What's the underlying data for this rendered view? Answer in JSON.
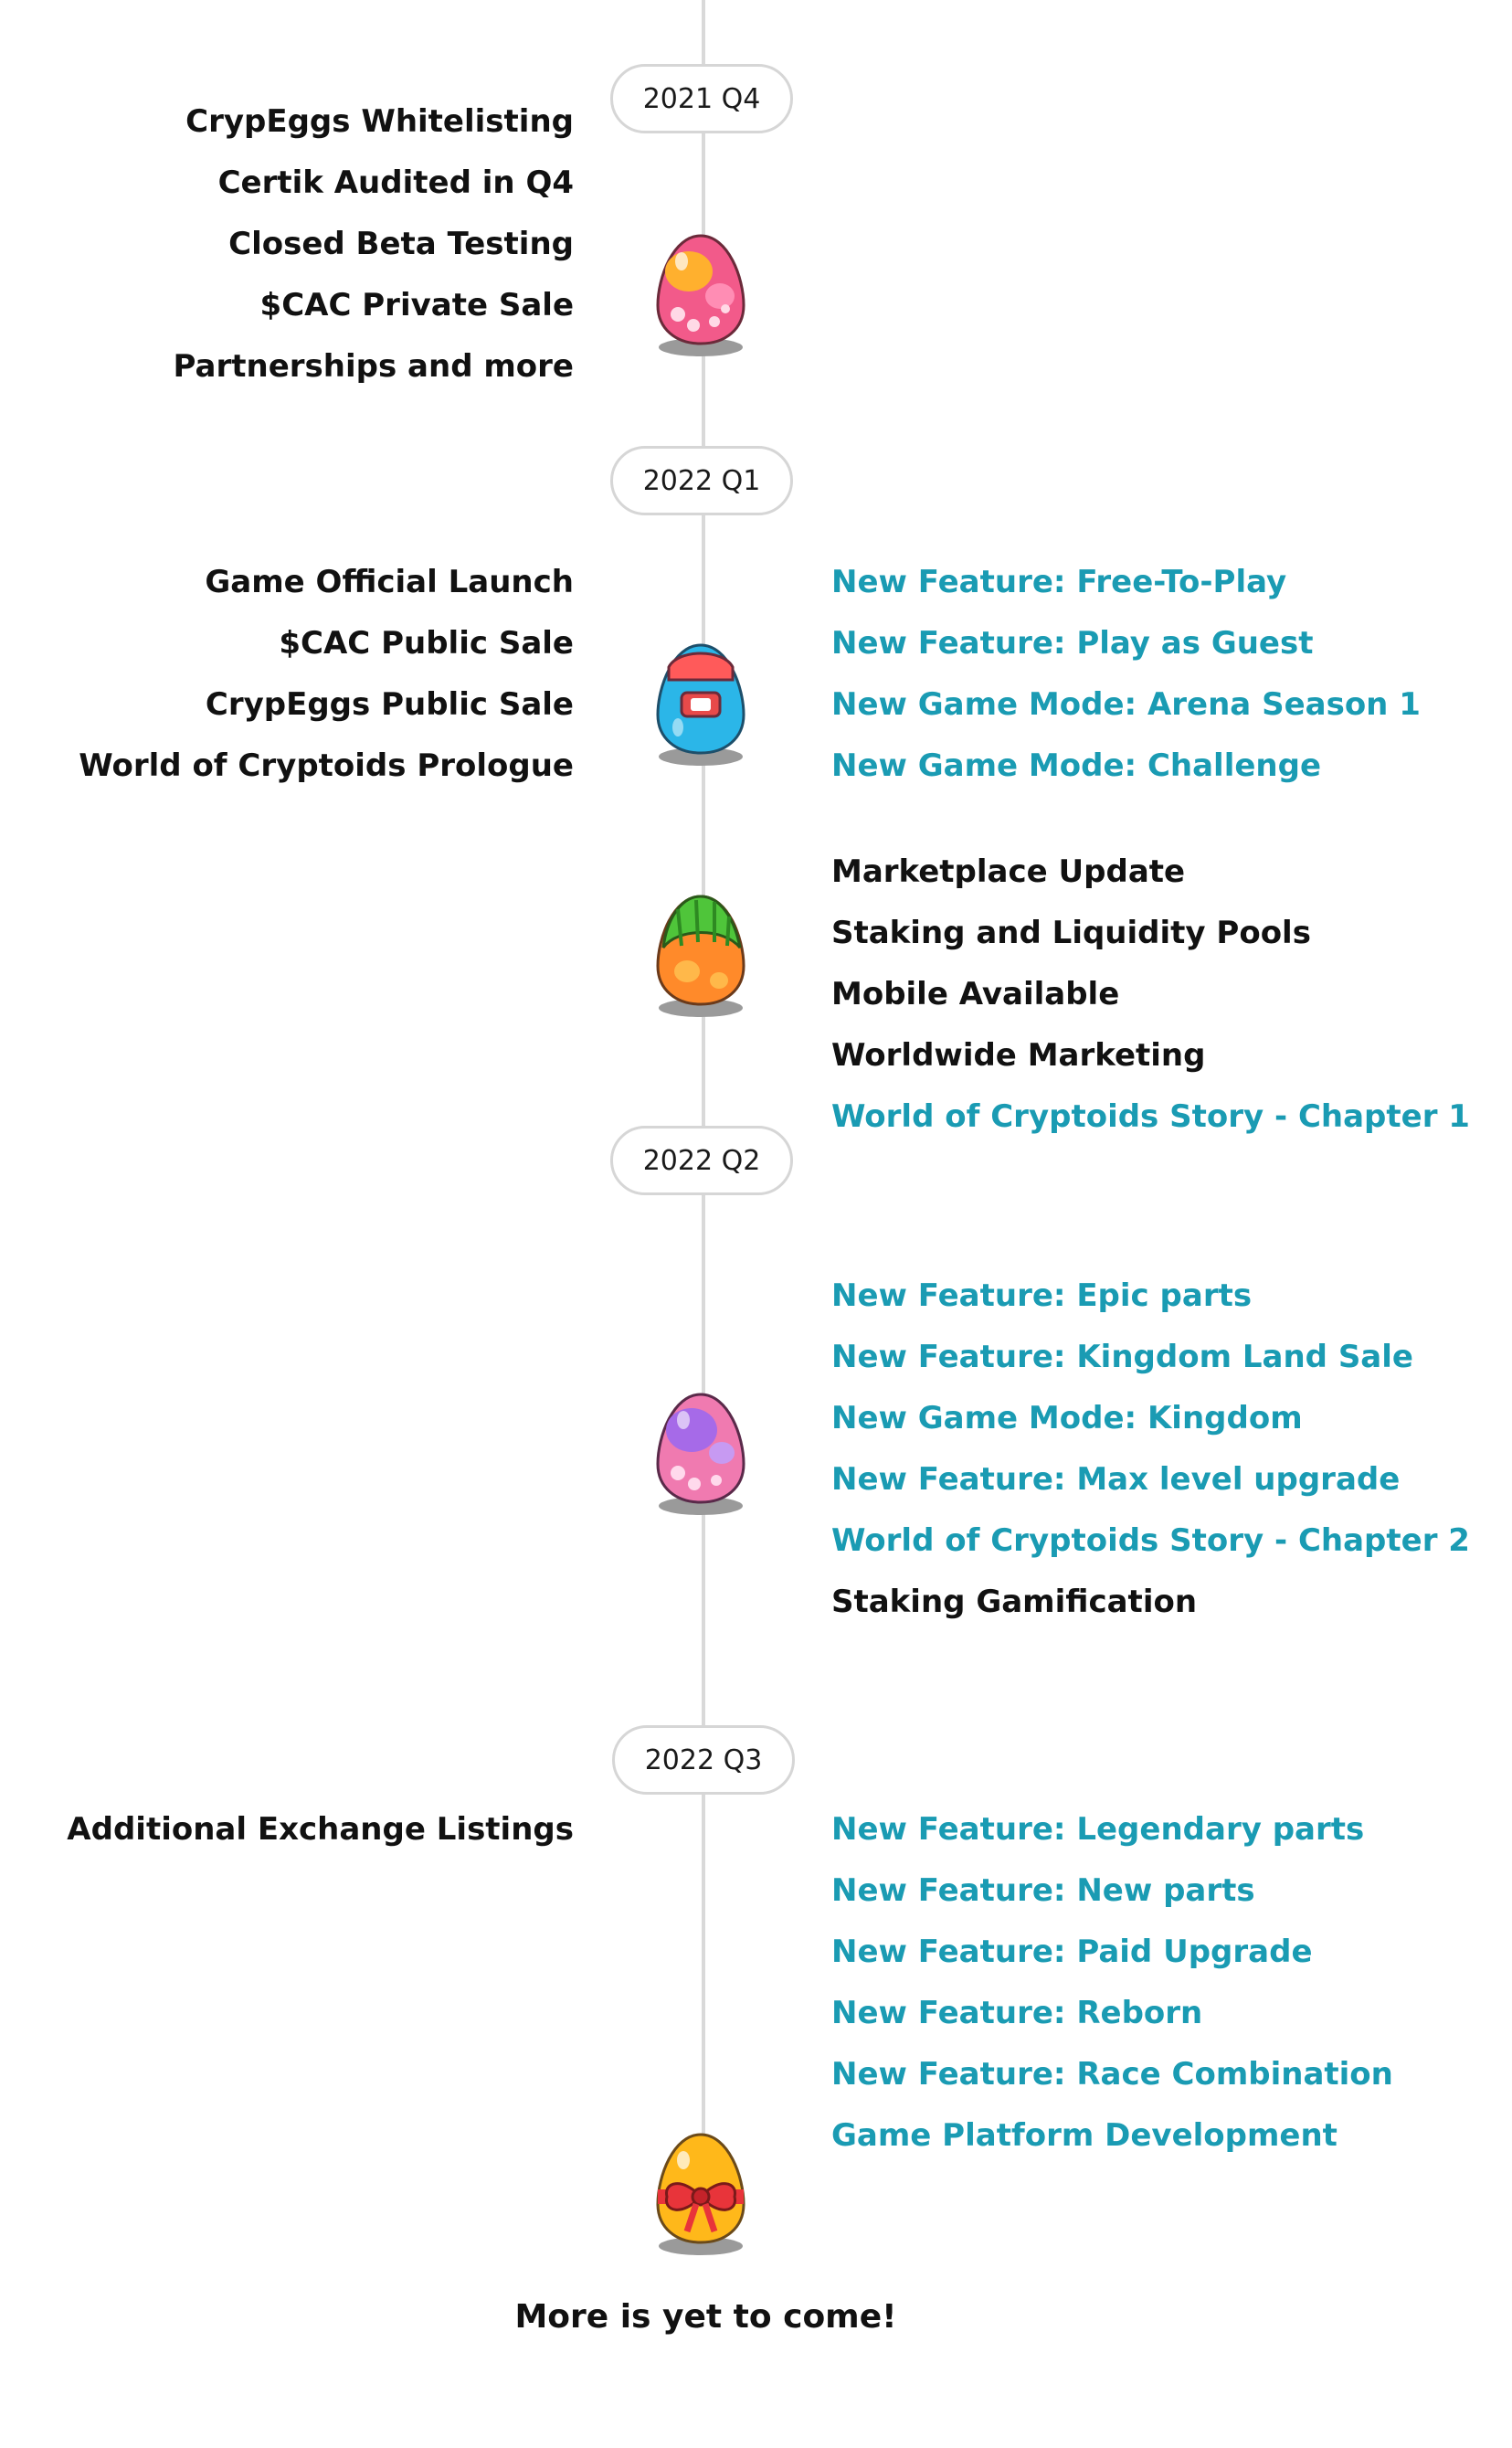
{
  "milestones": [
    {
      "label": "2021 Q4"
    },
    {
      "label": "2022 Q1"
    },
    {
      "label": "2022 Q2"
    },
    {
      "label": "2022 Q3"
    }
  ],
  "q4_2021": {
    "left": [
      "CrypEggs Whitelisting",
      "Certik Audited in Q4",
      "Closed Beta Testing",
      "$CAC Private Sale",
      "Partnerships and more"
    ]
  },
  "q1_2022": {
    "left": [
      "Game Official Launch",
      "$CAC Public Sale",
      "CrypEggs Public Sale",
      "World of Cryptoids Prologue"
    ],
    "right": [
      "New Feature: Free-To-Play",
      "New Feature: Play as Guest",
      "New Game Mode: Arena Season 1",
      "New Game Mode: Challenge"
    ],
    "right2": [
      "Marketplace Update",
      "Staking and Liquidity Pools",
      "Mobile Available",
      "Worldwide Marketing",
      "World of Cryptoids Story - Chapter 1"
    ]
  },
  "q2_2022": {
    "right": [
      "New Feature: Epic parts",
      "New Feature: Kingdom Land Sale",
      "New Game Mode: Kingdom",
      "New Feature: Max level upgrade",
      "World of Cryptoids Story - Chapter 2",
      "Staking Gamification"
    ]
  },
  "q3_2022": {
    "left": [
      "Additional Exchange Listings"
    ],
    "right": [
      "New Feature: Legendary parts",
      "New Feature: New parts",
      "New Feature: Paid Upgrade",
      "New Feature: Reborn",
      "New Feature: Race Combination",
      "Game Platform Development"
    ]
  },
  "footer": "More is yet to come!",
  "colors": {
    "teal": "#1a9bb3",
    "dark": "#111111",
    "line": "#d9d9d9"
  },
  "icons": [
    "pink-egg-icon",
    "blue-egg-icon",
    "green-egg-icon",
    "purple-egg-icon",
    "gift-egg-icon"
  ]
}
